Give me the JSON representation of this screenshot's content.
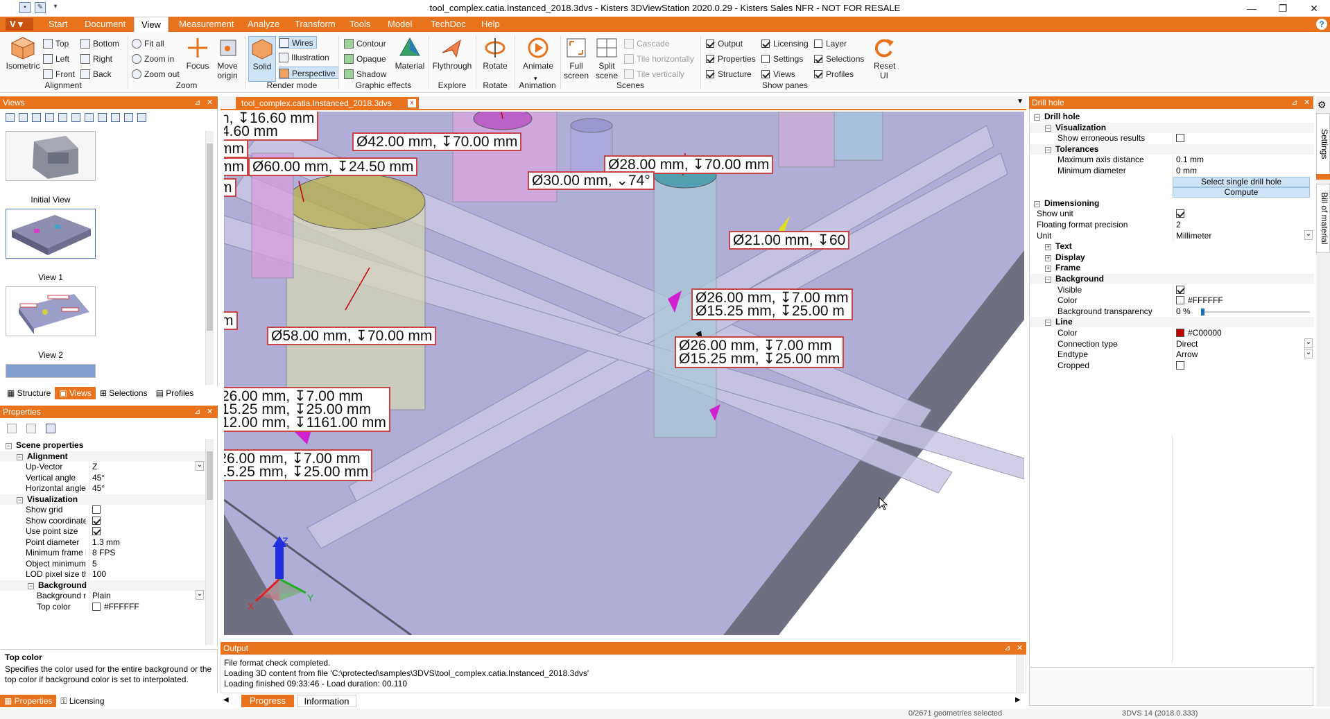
{
  "app": {
    "title": "tool_complex.catia.Instanced_2018.3dvs - Kisters 3DViewStation 2020.0.29 - Kisters Sales NFR - NOT FOR RESALE",
    "logo": "V"
  },
  "menu": {
    "tabs": [
      "Start",
      "Document",
      "View",
      "Measurement",
      "Analyze",
      "Transform",
      "Tools",
      "Model",
      "TechDoc",
      "Help"
    ],
    "active": "View",
    "help_glyph": "?"
  },
  "ribbon": {
    "alignment": {
      "label": "Alignment",
      "isometric": "Isometric",
      "top": "Top",
      "bottom": "Bottom",
      "left": "Left",
      "right": "Right",
      "front": "Front",
      "back": "Back"
    },
    "zoom": {
      "label": "Zoom",
      "fit_all": "Fit all",
      "zoom_in": "Zoom in",
      "zoom_out": "Zoom out",
      "focus": "Focus",
      "move_origin": "Move origin"
    },
    "render_mode": {
      "label": "Render mode",
      "solid": "Solid",
      "wires": "Wires",
      "illustration": "Illustration",
      "perspective": "Perspective"
    },
    "graphic_effects": {
      "label": "Graphic effects",
      "contour": "Contour",
      "opaque": "Opaque",
      "shadow": "Shadow",
      "material": "Material"
    },
    "explore": {
      "label": "Explore",
      "flythrough": "Flythrough"
    },
    "rotate": {
      "label": "Rotate",
      "rotate": "Rotate"
    },
    "animation": {
      "label": "Animation",
      "animate": "Animate"
    },
    "scenes": {
      "label": "Scenes",
      "full_screen": "Full screen",
      "split_scene": "Split scene",
      "cascade": "Cascade",
      "tile_h": "Tile horizontally",
      "tile_v": "Tile vertically"
    },
    "show_panes": {
      "label": "Show panes",
      "items": [
        {
          "label": "Output",
          "checked": true
        },
        {
          "label": "Properties",
          "checked": true
        },
        {
          "label": "Structure",
          "checked": true
        },
        {
          "label": "Licensing",
          "checked": true
        },
        {
          "label": "Settings",
          "checked": false
        },
        {
          "label": "Views",
          "checked": true
        },
        {
          "label": "Layer",
          "checked": false
        },
        {
          "label": "Selections",
          "checked": true
        },
        {
          "label": "Profiles",
          "checked": true
        }
      ],
      "reset_ui": "Reset UI"
    }
  },
  "views_panel": {
    "title": "Views",
    "thumbs": [
      "Initial View",
      "View 1",
      "View 2"
    ],
    "tabs": [
      "Structure",
      "Views",
      "Selections",
      "Profiles"
    ],
    "active_tab": "Views"
  },
  "properties_panel": {
    "title": "Properties",
    "rows": [
      {
        "type": "head",
        "label": "Scene properties",
        "level": 0
      },
      {
        "type": "head",
        "label": "Alignment",
        "level": 1
      },
      {
        "type": "prop",
        "label": "Up-Vector",
        "value": "Z",
        "dropdown": true
      },
      {
        "type": "prop",
        "label": "Vertical angle",
        "value": "45°"
      },
      {
        "type": "prop",
        "label": "Horizontal angle",
        "value": "45°"
      },
      {
        "type": "head",
        "label": "Visualization",
        "level": 1
      },
      {
        "type": "check",
        "label": "Show grid",
        "checked": false
      },
      {
        "type": "check",
        "label": "Show coordinate s...",
        "checked": true
      },
      {
        "type": "check",
        "label": "Use point size",
        "checked": true
      },
      {
        "type": "prop",
        "label": "Point diameter",
        "value": "1.3 mm"
      },
      {
        "type": "prop",
        "label": "Minimum frame r...",
        "value": "8 FPS"
      },
      {
        "type": "prop",
        "label": "Object minimum ...",
        "value": "5"
      },
      {
        "type": "prop",
        "label": "LOD pixel size thre...",
        "value": "100"
      },
      {
        "type": "head",
        "label": "Background",
        "level": 2
      },
      {
        "type": "prop",
        "label": "Background m...",
        "value": "Plain",
        "dropdown": true,
        "indent": true
      },
      {
        "type": "color",
        "label": "Top color",
        "value": "#FFFFFF",
        "swatch": "#FFFFFF",
        "indent": true
      }
    ],
    "help_title": "Top color",
    "help_text": "Specifies the color used for the entire background or the top color if background color is set to interpolated.",
    "tabs": [
      "Properties",
      "Licensing"
    ],
    "active_tab": "Properties"
  },
  "viewport": {
    "tab_label": "tool_complex.catia.Instanced_2018.3dvs",
    "close": "x",
    "annotations": [
      {
        "lines": [
          "h, ↧16.60 mm",
          "4.60 mm"
        ]
      },
      {
        "lines": [
          "mm"
        ]
      },
      {
        "lines": [
          "mm"
        ]
      },
      {
        "lines": [
          "m"
        ]
      },
      {
        "lines": [
          "Ø42.00 mm, ↧70.00 mm"
        ]
      },
      {
        "lines": [
          "Ø60.00 mm, ↧24.50 mm"
        ]
      },
      {
        "lines": [
          "Ø28.00 mm, ↧70.00 mm"
        ]
      },
      {
        "lines": [
          "Ø30.00 mm, ⌄74°"
        ]
      },
      {
        "lines": [
          "Ø21.00 mm, ↧60"
        ]
      },
      {
        "lines": [
          "Ø26.00 mm, ↧7.00 mm",
          "Ø15.25 mm, ↧25.00 m"
        ]
      },
      {
        "lines": [
          "Ø26.00 mm, ↧7.00 mm",
          "Ø15.25 mm, ↧25.00 mm"
        ]
      },
      {
        "lines": [
          "m"
        ]
      },
      {
        "lines": [
          "Ø58.00 mm, ↧70.00 mm"
        ]
      },
      {
        "lines": [
          "26.00 mm, ↧7.00 mm",
          "15.25 mm, ↧25.00 mm",
          "12.00 mm, ↧1161.00 mm"
        ]
      },
      {
        "lines": [
          "Ø26.00 mm, ↧7.00 mm",
          "Ø15.25 mm, ↧25.00 mm"
        ]
      }
    ],
    "axes": {
      "x": "X",
      "y": "Y",
      "z": "Z"
    }
  },
  "output_panel": {
    "title": "Output",
    "lines": [
      "File format check completed.",
      "Loading 3D content from file 'C:\\protected\\samples\\3DVS\\tool_complex.catia.Instanced_2018.3dvs'",
      "Loading finished 09:33:46 - Load duration: 00.110"
    ],
    "tabs": [
      "Progress",
      "Information"
    ],
    "active_tab": "Progress"
  },
  "drill_panel": {
    "title": "Drill hole",
    "rows": [
      {
        "type": "head",
        "label": "Drill hole",
        "level": 0
      },
      {
        "type": "head",
        "label": "Visualization",
        "level": 1
      },
      {
        "type": "check",
        "label": "Show erroneous results",
        "checked": false
      },
      {
        "type": "head",
        "label": "Tolerances",
        "level": 1
      },
      {
        "type": "prop",
        "label": "Maximum axis distance",
        "value": "0.1 mm"
      },
      {
        "type": "prop",
        "label": "Minimum diameter",
        "value": "0 mm"
      },
      {
        "type": "button",
        "label": "Select single drill hole"
      },
      {
        "type": "button",
        "label": "Compute"
      },
      {
        "type": "head",
        "label": "Dimensioning",
        "level": 0
      },
      {
        "type": "check",
        "label": "Show unit",
        "checked": true,
        "flat": true
      },
      {
        "type": "prop",
        "label": "Floating format precision",
        "value": "2",
        "flat": true
      },
      {
        "type": "prop",
        "label": "Unit",
        "value": "Millimeter",
        "dropdown": true,
        "flat": true
      },
      {
        "type": "phead",
        "label": "Text"
      },
      {
        "type": "phead",
        "label": "Display"
      },
      {
        "type": "phead",
        "label": "Frame"
      },
      {
        "type": "head",
        "label": "Background",
        "level": 1
      },
      {
        "type": "check",
        "label": "Visible",
        "checked": true
      },
      {
        "type": "color",
        "label": "Color",
        "value": "#FFFFFF",
        "swatch": "#FFFFFF"
      },
      {
        "type": "slider",
        "label": "Background transparency",
        "value": "0 %",
        "fraction": 0.0
      },
      {
        "type": "head",
        "label": "Line",
        "level": 1
      },
      {
        "type": "color",
        "label": "Color",
        "value": "#C00000",
        "swatch": "#C00000"
      },
      {
        "type": "prop",
        "label": "Connection type",
        "value": "Direct",
        "dropdown": true
      },
      {
        "type": "prop",
        "label": "Endtype",
        "value": "Arrow",
        "dropdown": true
      },
      {
        "type": "check",
        "label": "Cropped",
        "checked": false
      }
    ]
  },
  "side_tabs": [
    "Settings",
    "Bill of material"
  ],
  "status": {
    "selection": "0/2671 geometries selected",
    "version": "3DVS 14 (2018.0.333)"
  }
}
